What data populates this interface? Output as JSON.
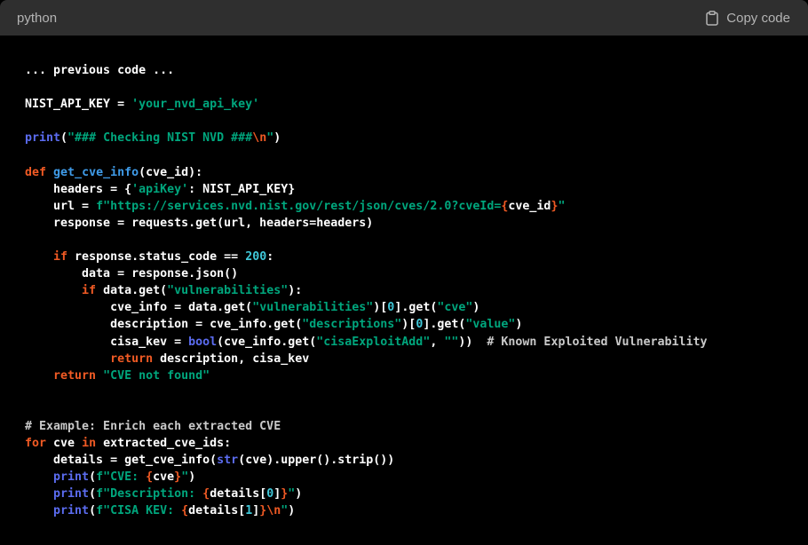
{
  "header": {
    "language": "python",
    "copy_label": "Copy code",
    "copy_icon": "clipboard-icon"
  },
  "code_lines": [
    [
      {
        "t": "... previous code ...",
        "c": ""
      }
    ],
    [],
    [
      {
        "t": "NIST_API_KEY = ",
        "c": ""
      },
      {
        "t": "'your_nvd_api_key'",
        "c": "str"
      }
    ],
    [],
    [
      {
        "t": "print",
        "c": "bi"
      },
      {
        "t": "(",
        "c": ""
      },
      {
        "t": "\"### Checking NIST NVD ###",
        "c": "str"
      },
      {
        "t": "\\n",
        "c": "esc"
      },
      {
        "t": "\"",
        "c": "str"
      },
      {
        "t": ")",
        "c": ""
      }
    ],
    [],
    [
      {
        "t": "def",
        "c": "kw"
      },
      {
        "t": " ",
        "c": ""
      },
      {
        "t": "get_cve_info",
        "c": "fn"
      },
      {
        "t": "(cve_id):",
        "c": ""
      }
    ],
    [
      {
        "t": "    headers = {",
        "c": ""
      },
      {
        "t": "'apiKey'",
        "c": "str"
      },
      {
        "t": ": NIST_API_KEY}",
        "c": ""
      }
    ],
    [
      {
        "t": "    url = ",
        "c": ""
      },
      {
        "t": "f\"https://services.nvd.nist.gov/rest/json/cves/2.0?cveId=",
        "c": "str"
      },
      {
        "t": "{",
        "c": "esc"
      },
      {
        "t": "cve_id",
        "c": ""
      },
      {
        "t": "}",
        "c": "esc"
      },
      {
        "t": "\"",
        "c": "str"
      }
    ],
    [
      {
        "t": "    response = requests.get(url, headers=headers)",
        "c": ""
      }
    ],
    [],
    [
      {
        "t": "    ",
        "c": ""
      },
      {
        "t": "if",
        "c": "kw"
      },
      {
        "t": " response.status_code == ",
        "c": ""
      },
      {
        "t": "200",
        "c": "num"
      },
      {
        "t": ":",
        "c": ""
      }
    ],
    [
      {
        "t": "        data = response.json()",
        "c": ""
      }
    ],
    [
      {
        "t": "        ",
        "c": ""
      },
      {
        "t": "if",
        "c": "kw"
      },
      {
        "t": " data.get(",
        "c": ""
      },
      {
        "t": "\"vulnerabilities\"",
        "c": "str"
      },
      {
        "t": "):",
        "c": ""
      }
    ],
    [
      {
        "t": "            cve_info = data.get(",
        "c": ""
      },
      {
        "t": "\"vulnerabilities\"",
        "c": "str"
      },
      {
        "t": ")[",
        "c": ""
      },
      {
        "t": "0",
        "c": "num"
      },
      {
        "t": "].get(",
        "c": ""
      },
      {
        "t": "\"cve\"",
        "c": "str"
      },
      {
        "t": ")",
        "c": ""
      }
    ],
    [
      {
        "t": "            description = cve_info.get(",
        "c": ""
      },
      {
        "t": "\"descriptions\"",
        "c": "str"
      },
      {
        "t": ")[",
        "c": ""
      },
      {
        "t": "0",
        "c": "num"
      },
      {
        "t": "].get(",
        "c": ""
      },
      {
        "t": "\"value\"",
        "c": "str"
      },
      {
        "t": ")",
        "c": ""
      }
    ],
    [
      {
        "t": "            cisa_kev = ",
        "c": ""
      },
      {
        "t": "bool",
        "c": "bi"
      },
      {
        "t": "(cve_info.get(",
        "c": ""
      },
      {
        "t": "\"cisaExploitAdd\"",
        "c": "str"
      },
      {
        "t": ", ",
        "c": ""
      },
      {
        "t": "\"\"",
        "c": "str"
      },
      {
        "t": "))  ",
        "c": ""
      },
      {
        "t": "# Known Exploited Vulnerability",
        "c": "cm"
      }
    ],
    [
      {
        "t": "            ",
        "c": ""
      },
      {
        "t": "return",
        "c": "kw"
      },
      {
        "t": " description, cisa_kev",
        "c": ""
      }
    ],
    [
      {
        "t": "    ",
        "c": ""
      },
      {
        "t": "return",
        "c": "kw"
      },
      {
        "t": " ",
        "c": ""
      },
      {
        "t": "\"CVE not found\"",
        "c": "str"
      }
    ],
    [],
    [],
    [
      {
        "t": "# Example: Enrich each extracted CVE",
        "c": "cm"
      }
    ],
    [
      {
        "t": "for",
        "c": "kw"
      },
      {
        "t": " cve ",
        "c": ""
      },
      {
        "t": "in",
        "c": "kw"
      },
      {
        "t": " extracted_cve_ids:",
        "c": ""
      }
    ],
    [
      {
        "t": "    details = get_cve_info(",
        "c": ""
      },
      {
        "t": "str",
        "c": "bi"
      },
      {
        "t": "(cve).upper().strip())",
        "c": ""
      }
    ],
    [
      {
        "t": "    ",
        "c": ""
      },
      {
        "t": "print",
        "c": "bi"
      },
      {
        "t": "(",
        "c": ""
      },
      {
        "t": "f\"CVE: ",
        "c": "str"
      },
      {
        "t": "{",
        "c": "esc"
      },
      {
        "t": "cve",
        "c": ""
      },
      {
        "t": "}",
        "c": "esc"
      },
      {
        "t": "\"",
        "c": "str"
      },
      {
        "t": ")",
        "c": ""
      }
    ],
    [
      {
        "t": "    ",
        "c": ""
      },
      {
        "t": "print",
        "c": "bi"
      },
      {
        "t": "(",
        "c": ""
      },
      {
        "t": "f\"Description: ",
        "c": "str"
      },
      {
        "t": "{",
        "c": "esc"
      },
      {
        "t": "details[",
        "c": ""
      },
      {
        "t": "0",
        "c": "num"
      },
      {
        "t": "]",
        "c": ""
      },
      {
        "t": "}",
        "c": "esc"
      },
      {
        "t": "\"",
        "c": "str"
      },
      {
        "t": ")",
        "c": ""
      }
    ],
    [
      {
        "t": "    ",
        "c": ""
      },
      {
        "t": "print",
        "c": "bi"
      },
      {
        "t": "(",
        "c": ""
      },
      {
        "t": "f\"CISA KEV: ",
        "c": "str"
      },
      {
        "t": "{",
        "c": "esc"
      },
      {
        "t": "details[",
        "c": ""
      },
      {
        "t": "1",
        "c": "num"
      },
      {
        "t": "]",
        "c": ""
      },
      {
        "t": "}",
        "c": "esc"
      },
      {
        "t": "\\n",
        "c": "esc"
      },
      {
        "t": "\"",
        "c": "str"
      },
      {
        "t": ")",
        "c": ""
      }
    ]
  ]
}
